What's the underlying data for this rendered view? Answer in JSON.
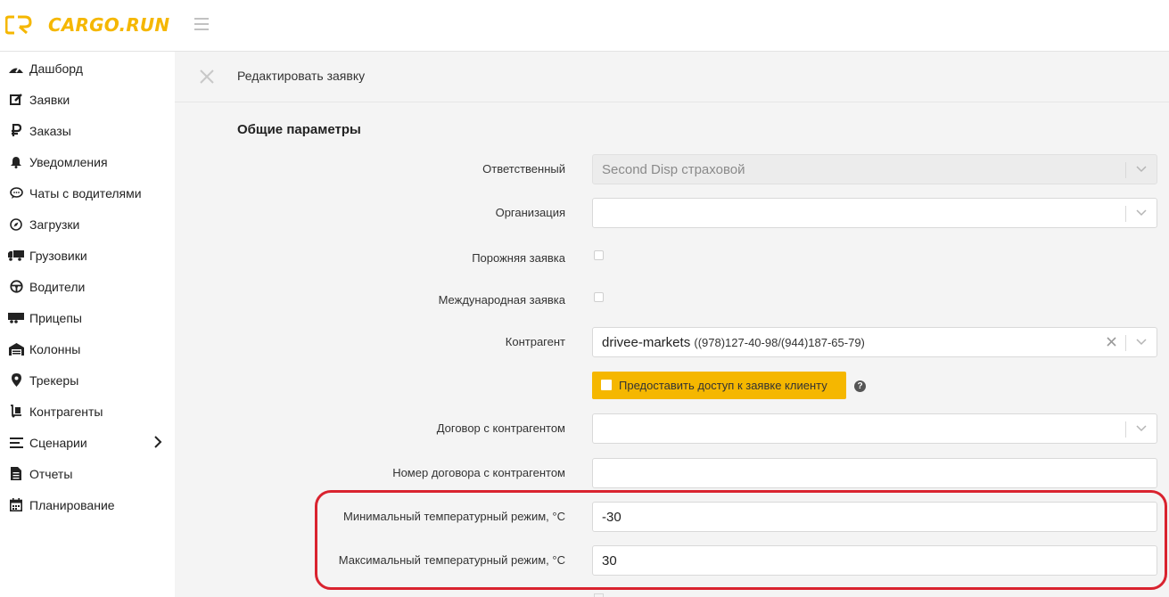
{
  "app": {
    "logo_text": "CARGO.RUN",
    "brand_color": "#f5b700"
  },
  "sidebar": {
    "items": [
      {
        "label": "Дашборд",
        "icon": "dashboard-icon"
      },
      {
        "label": "Заявки",
        "icon": "edit-icon"
      },
      {
        "label": "Заказы",
        "icon": "ruble-icon"
      },
      {
        "label": "Уведомления",
        "icon": "bell-icon"
      },
      {
        "label": "Чаты с водителями",
        "icon": "chat-icon"
      },
      {
        "label": "Загрузки",
        "icon": "compass-icon"
      },
      {
        "label": "Грузовики",
        "icon": "truck-icon"
      },
      {
        "label": "Водители",
        "icon": "steering-wheel-icon"
      },
      {
        "label": "Прицепы",
        "icon": "trailer-icon"
      },
      {
        "label": "Колонны",
        "icon": "warehouse-icon"
      },
      {
        "label": "Трекеры",
        "icon": "map-marker-icon"
      },
      {
        "label": "Контрагенты",
        "icon": "dolly-icon"
      },
      {
        "label": "Сценарии",
        "icon": "list-icon",
        "has_submenu": true
      },
      {
        "label": "Отчеты",
        "icon": "report-icon"
      },
      {
        "label": "Планирование",
        "icon": "calendar-icon"
      }
    ]
  },
  "topbar": {
    "title": "Редактировать заявку"
  },
  "form": {
    "section_title": "Общие параметры",
    "responsible": {
      "label": "Ответственный",
      "value": "Second Disp страховой"
    },
    "organization": {
      "label": "Организация",
      "value": ""
    },
    "empty_request": {
      "label": "Порожняя заявка",
      "checked": false
    },
    "international": {
      "label": "Международная заявка",
      "checked": false
    },
    "counterparty": {
      "label": "Контрагент",
      "value": "drivee-markets",
      "phones": "((978)127-40-98/(944)187-65-79)"
    },
    "share_access": {
      "label": "Предоставить доступ к заявке клиенту",
      "checked": false
    },
    "contract": {
      "label": "Договор с контрагентом",
      "value": ""
    },
    "contract_number": {
      "label": "Номер договора с контрагентом",
      "value": ""
    },
    "min_temp": {
      "label": "Минимальный температурный режим, °С",
      "value": "-30"
    },
    "max_temp": {
      "label": "Максимальный температурный режим, °С",
      "value": "30"
    }
  },
  "highlight_color": "#d9232f"
}
